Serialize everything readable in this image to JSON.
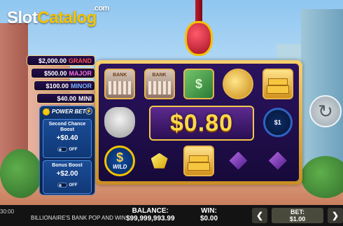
{
  "logo": {
    "slot": "Slot",
    "catalog": "Catalog",
    "com": ".com"
  },
  "jackpots": [
    {
      "amount": "$2,000.00",
      "label": "GRAND"
    },
    {
      "amount": "$500.00",
      "label": "MAJOR"
    },
    {
      "amount": "$100.00",
      "label": "MINOR"
    },
    {
      "amount": "$40.00",
      "label": "MINI"
    }
  ],
  "power_bet": {
    "title": "POWER BET",
    "options": [
      {
        "title": "Second Chance Boost",
        "price": "+$0.40",
        "toggle": "OFF"
      },
      {
        "title": "Bonus Boost",
        "price": "+$2.00",
        "toggle": "OFF"
      }
    ]
  },
  "reels": {
    "win_amount": "$0.80",
    "blue_coin_value": "$1",
    "wild_label": "WILD",
    "bank_label": "BANK"
  },
  "bottom_bar": {
    "clock": "30:00",
    "game_name": "BILLIONAIRE'S BANK POP AND WIN",
    "balance_label": "BALANCE:",
    "balance_value": "$99,999,993.99",
    "win_label": "WIN:",
    "win_value": "$0.00",
    "bet_label": "BET:",
    "bet_value": "$1.00",
    "prev_arrow": "❮",
    "next_arrow": "❯"
  },
  "colors": {
    "accent": "#f3c300",
    "grand": "#ff4f4f",
    "major": "#ff6fd1",
    "minor": "#7db6ff",
    "frame": "#e8b44a"
  }
}
